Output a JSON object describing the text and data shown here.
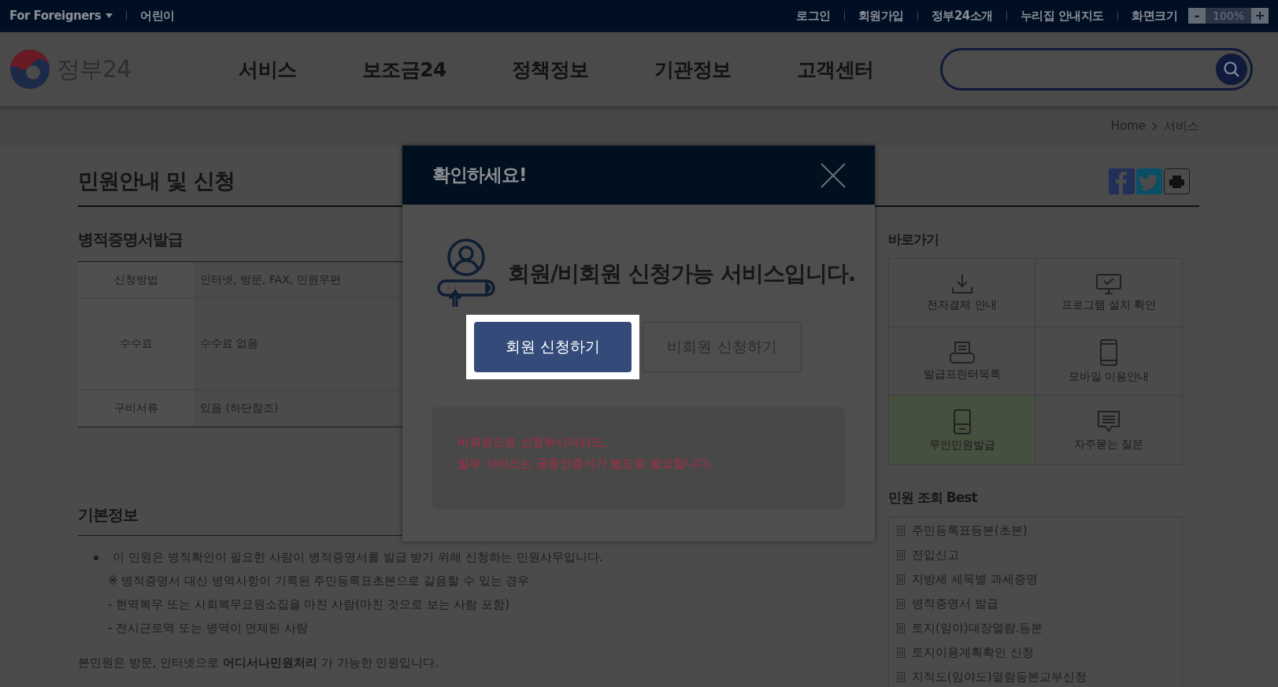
{
  "top_bar": {
    "left_links": [
      "For Foreigners",
      "어린이"
    ],
    "right_links": [
      "로그인",
      "회원가입",
      "정부24소개",
      "누리집 안내지도"
    ],
    "zoom": {
      "label": "화면크기",
      "minus": "-",
      "value": "100%",
      "plus": "+"
    }
  },
  "header": {
    "logo": "정부24",
    "nav": [
      "서비스",
      "보조금24",
      "정책정보",
      "기관정보",
      "고객센터"
    ]
  },
  "breadcrumb": [
    "Home",
    "서비스"
  ],
  "page_title": "민원안내 및 신청",
  "service": {
    "title": "병적증명서발급",
    "rows": [
      {
        "label": "신청방법",
        "value": "인터넷, 방문, FAX, 민원우편"
      },
      {
        "label": "수수료",
        "value": "수수료 없음"
      },
      {
        "label": "구비서류",
        "value": "있음 (하단참조)"
      }
    ]
  },
  "basic_info": {
    "title": "기본정보",
    "bullet": "이 민원은 병적확인이 필요한 사람이 병적증명서를 발급 받기 위해 신청하는 민원사무입니다.",
    "lines": [
      "※ 병적증명서 대신 병역사항이 기록된 주민등록표초본으로 갈음할 수 있는 경우",
      "- 현역복무 또는 사회복무요원소집을 마친 사람(마친 것으로 보는 사람 포함)",
      "- 전시근로역 또는 병역이 면제된 사람"
    ],
    "note": "본민원은 방문, 인터넷으로 **어디서나민원처리** 가 가능한 민원입니다."
  },
  "shortcuts": {
    "title": "바로가기",
    "items": [
      {
        "kind": "download",
        "label": "전자결제 안내",
        "highlighted": false
      },
      {
        "kind": "monitor",
        "label": "프로그램 설치 확인",
        "highlighted": false
      },
      {
        "kind": "printer",
        "label": "발급프린터목록",
        "highlighted": false
      },
      {
        "kind": "phone",
        "label": "모바일 이용안내",
        "highlighted": false
      },
      {
        "kind": "kiosk",
        "label": "무인민원발급",
        "highlighted": true
      },
      {
        "kind": "chat",
        "label": "자주묻는 질문",
        "highlighted": false
      }
    ]
  },
  "best": {
    "title": "민원 조회 Best",
    "items": [
      "주민등록표등본(초본)",
      "전입신고",
      "지방세 세목별 과세증명",
      "병적증명서 발급",
      "토지(임야)대장열람.등본",
      "토지이용계획확인 신청",
      "지적도(임야도)열람등본교부신청"
    ]
  },
  "modal": {
    "title": "확인하세요!",
    "headline": "회원/비회원 신청가능 서비스입니다.",
    "buttons": [
      {
        "label": "회원 신청하기",
        "selected": true
      },
      {
        "label": "비회원 신청하기",
        "selected": false
      }
    ],
    "notes": [
      "비회원으로 신청하시더라도,",
      "일부 서비스는 공동인증서가 별도로 필요힙니다."
    ]
  }
}
